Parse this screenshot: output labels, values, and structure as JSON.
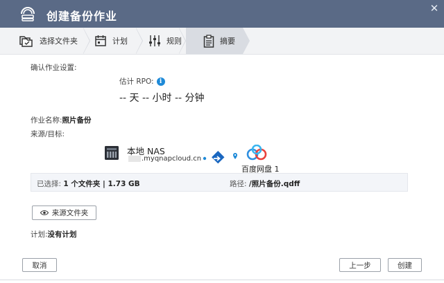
{
  "window": {
    "title": "创建备份作业",
    "close_glyph": "✕"
  },
  "steps": [
    {
      "label": "选择文件夹",
      "icon": "folder-select-icon"
    },
    {
      "label": "计划",
      "icon": "calendar-icon"
    },
    {
      "label": "规则",
      "icon": "sliders-icon"
    },
    {
      "label": "摘要",
      "icon": "clipboard-icon",
      "active": true
    }
  ],
  "confirm": {
    "heading": "确认作业设置:"
  },
  "rpo": {
    "label": "估计 RPO:",
    "info_glyph": "i",
    "value": "-- 天 -- 小时 -- 分钟"
  },
  "job": {
    "name_label": "作业名称:",
    "name_value": "照片备份"
  },
  "source_target": {
    "label": "来源/目标:",
    "source_name": "本地 NAS",
    "source_host": ".myqnapcloud.cn",
    "target_name": "百度网盘 1"
  },
  "summary": {
    "selected_label": "已选择:",
    "selected_value": "1 个文件夹 | 1.73 GB",
    "path_label": "路径:",
    "path_value": "/照片备份.qdff"
  },
  "source_folder_button": {
    "label": "来源文件夹"
  },
  "schedule": {
    "label": "计划:",
    "value": "没有计划"
  },
  "buttons": {
    "cancel": "取消",
    "prev": "上一步",
    "create": "创建"
  },
  "colors": {
    "titlebar": "#5a6a86",
    "accent": "#1e8ad8",
    "arrow": "#1a67c0"
  }
}
